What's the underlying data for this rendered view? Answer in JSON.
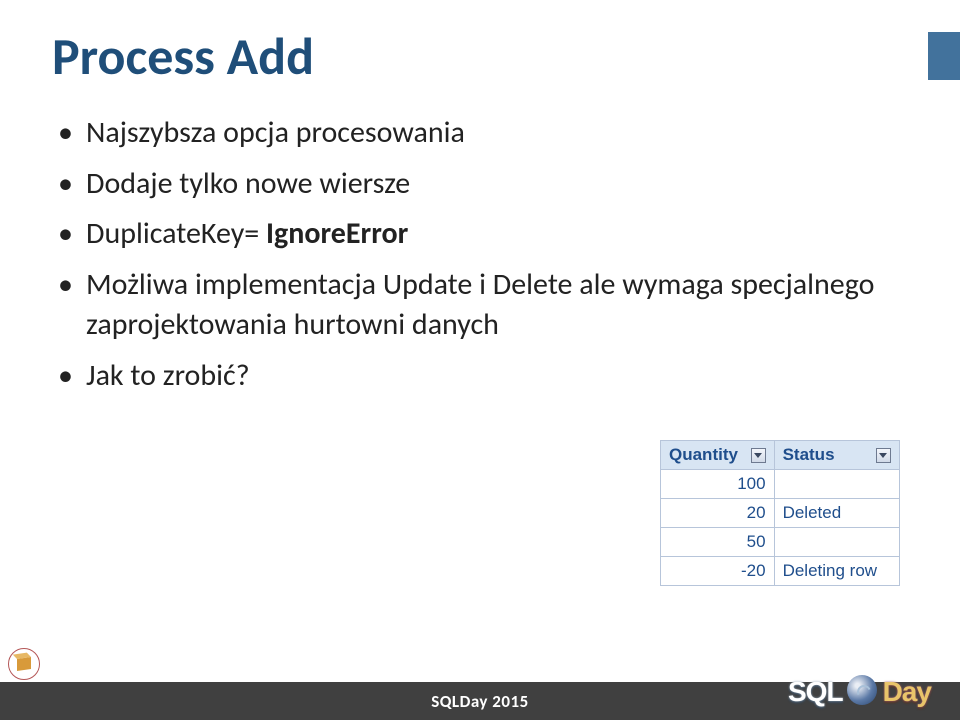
{
  "title": "Process Add",
  "bullets": {
    "b0": "Najszybsza opcja procesowania",
    "b1": "Dodaje tylko nowe wiersze",
    "b2_prefix": "DuplicateKey= ",
    "b2_bold": "IgnoreError",
    "b3": "Możliwa implementacja Update i Delete ale wymaga specjalnego zaprojektowania hurtowni danych",
    "b4": "Jak to zrobić?"
  },
  "table": {
    "headers": {
      "qty": "Quantity",
      "status": "Status"
    },
    "rows": [
      {
        "qty": "100",
        "status": ""
      },
      {
        "qty": "20",
        "status": "Deleted"
      },
      {
        "qty": "50",
        "status": ""
      },
      {
        "qty": "-20",
        "status": "Deleting row"
      }
    ]
  },
  "footer": "SQLDay 2015",
  "logo": {
    "left": "SQL",
    "right": "Day"
  }
}
